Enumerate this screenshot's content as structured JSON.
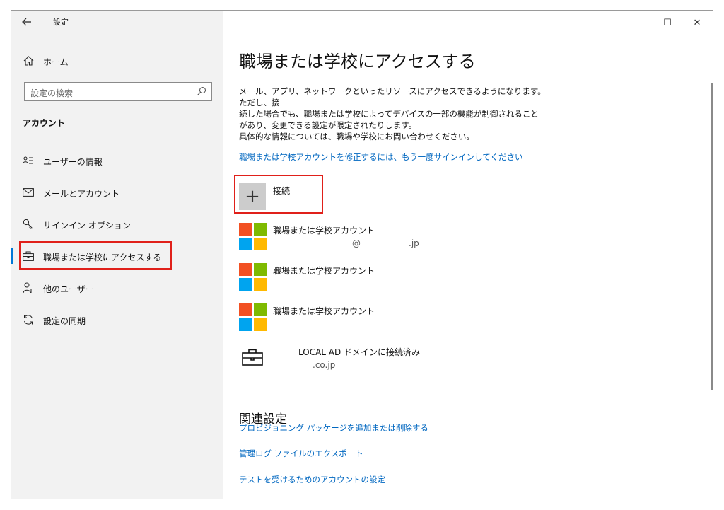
{
  "window": {
    "app_title": "設定",
    "controls": {
      "minimize": "—",
      "maximize": "☐",
      "close": "✕"
    }
  },
  "sidebar": {
    "back_icon": "back-arrow-icon",
    "home_label": "ホーム",
    "search_placeholder": "設定の検索",
    "section_title": "アカウント",
    "items": [
      {
        "label": "ユーザーの情報",
        "icon": "user-info-icon"
      },
      {
        "label": "メールとアカウント",
        "icon": "mail-icon"
      },
      {
        "label": "サインイン オプション",
        "icon": "key-icon"
      },
      {
        "label": "職場または学校にアクセスする",
        "icon": "briefcase-icon",
        "selected": true
      },
      {
        "label": "他のユーザー",
        "icon": "add-person-icon"
      },
      {
        "label": "設定の同期",
        "icon": "sync-icon"
      }
    ]
  },
  "main": {
    "title": "職場または学校にアクセスする",
    "description": [
      "メール、アプリ、ネットワークといったリソースにアクセスできるようになります。ただし、接",
      "続した場合でも、職場または学校によってデバイスの一部の機能が制御されること",
      "があり、変更できる設定が限定されたりします。",
      "具体的な情報については、職場や学校にお問い合わせください。"
    ],
    "reauth_link": "職場または学校アカウントを修正するには、もう一度サインインしてください",
    "connect_label": "接続",
    "accounts": [
      {
        "title": "職場または学校アカウント",
        "sub_a": "@",
        "sub_b": ".jp"
      },
      {
        "title": "職場または学校アカウント"
      },
      {
        "title": "職場または学校アカウント"
      }
    ],
    "domain_account": {
      "title": "LOCAL AD ドメインに接続済み",
      "sub": ".co.jp"
    },
    "related_title": "関連設定",
    "related_links": [
      "プロビジョニング パッケージを追加または削除する",
      "管理ログ ファイルのエクスポート",
      "テストを受けるためのアカウントの設定"
    ]
  },
  "colors": {
    "accent": "#0078d7",
    "link": "#0067c0",
    "highlight_border": "#e0201a",
    "ms_red": "#f25022",
    "ms_green": "#7fba00",
    "ms_blue": "#00a4ef",
    "ms_yellow": "#ffb900"
  }
}
